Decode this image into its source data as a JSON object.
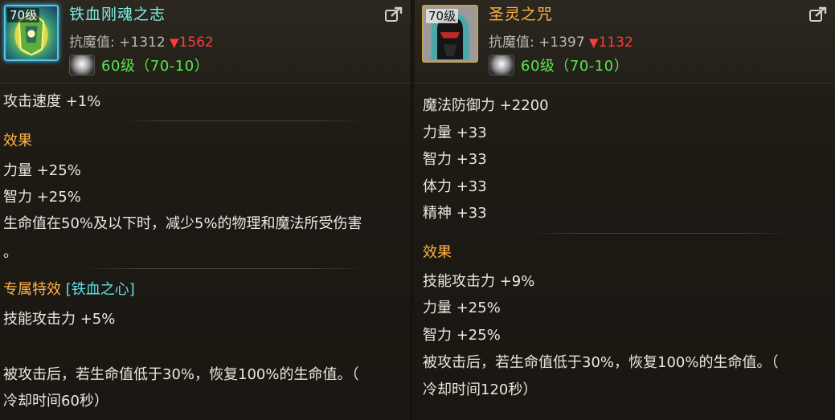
{
  "left_item": {
    "level": "70级",
    "name": "铁血刚魂之志",
    "mres_label": "抗魔值: +1312",
    "mres_down": "1562",
    "grade": "60级（70-10）",
    "icon": "golden-armor-icon",
    "base_stat": "攻击速度 +1%",
    "effect_title": "效果",
    "effects": [
      "力量 +25%",
      "智力 +25%",
      "生命值在50%及以下时，减少5%的物理和魔法所受伤害",
      "。"
    ],
    "exclusive_title": "专属特效",
    "exclusive_name": "[铁血之心]",
    "exclusive_stats": [
      "技能攻击力 +5%"
    ],
    "passive": [
      "被攻击后，若生命值低于30%，恢复100%的生命值。（",
      "冷却时间60秒）"
    ]
  },
  "right_item": {
    "level": "70级",
    "name": "圣灵之咒",
    "mres_label": "抗魔值: +1397",
    "mres_down": "1132",
    "grade": "60级（70-10）",
    "icon": "masked-helmet-icon",
    "base_stats": [
      "魔法防御力 +2200",
      "力量 +33",
      "智力 +33",
      "体力 +33",
      "精神 +33"
    ],
    "effect_title": "效果",
    "effects": [
      "技能攻击力 +9%",
      "力量 +25%",
      "智力 +25%"
    ],
    "passive": [
      "被攻击后，若生命值低于30%，恢复100%的生命值。（",
      "冷却时间120秒）"
    ]
  },
  "colors": {
    "left_name": "#7cf0e8",
    "right_name": "#ffb347",
    "grade": "#56e84c",
    "decrease": "#ff3b3b",
    "section_title": "#ffb347"
  }
}
